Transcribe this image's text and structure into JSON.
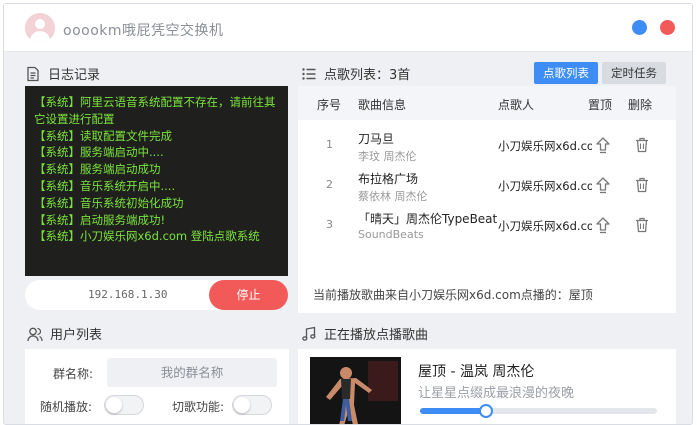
{
  "app": {
    "title": "ooookm哦屁凭空交换机"
  },
  "log": {
    "title": "日志记录",
    "lines": [
      "【系统】阿里云语音系统配置不存在，请前往其它设置进行配置",
      "【系统】读取配置文件完成",
      "【系统】服务端启动中....",
      "【系统】服务端启动成功",
      "【系统】音乐系统开启中....",
      "【系统】音乐系统初始化成功",
      "【系统】启动服务端成功!",
      "【系统】小刀娱乐网x6d.com 登陆点歌系统"
    ],
    "ip": "192.168.1.30",
    "stop_label": "停止"
  },
  "song_list": {
    "title": "点歌列表：3首",
    "tabs": [
      "点歌列表",
      "定时任务"
    ],
    "columns": [
      "序号",
      "歌曲信息",
      "点歌人",
      "置顶",
      "删除"
    ],
    "rows": [
      {
        "no": "1",
        "title": "刀马旦",
        "artist": "李玟  周杰伦",
        "requester": "小刀娱乐网x6d.com"
      },
      {
        "no": "2",
        "title": "布拉格广场",
        "artist": "蔡依林  周杰伦",
        "requester": "小刀娱乐网x6d.com"
      },
      {
        "no": "3",
        "title": "「晴天」周杰伦TypeBeat",
        "artist": "SoundBeats",
        "requester": "小刀娱乐网x6d.com"
      }
    ],
    "footer": "当前播放歌曲来自小刀娱乐网x6d.com点播的：屋顶"
  },
  "users": {
    "title": "用户列表",
    "group_label": "群名称:",
    "group_placeholder": "我的群名称",
    "random_label": "随机播放:",
    "cut_label": "切歌功能:"
  },
  "now_playing": {
    "title": "正在播放点播歌曲",
    "song": "屋顶 - 温岚  周杰伦",
    "lyric": "让星星点缀成最浪漫的夜晚",
    "progress": 0.28
  },
  "colors": {
    "accent": "#3d8df5",
    "danger": "#f25a5a",
    "log_text": "#7be33d",
    "log_bg": "#1f201d"
  }
}
